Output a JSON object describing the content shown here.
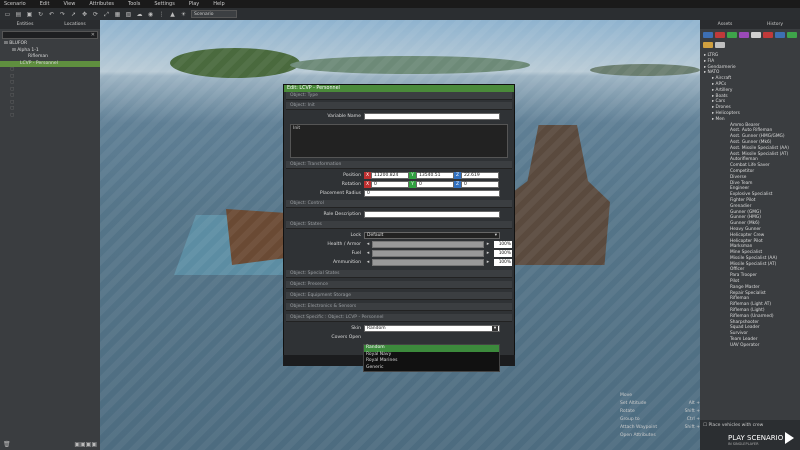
{
  "menubar": [
    "Scenario",
    "Edit",
    "View",
    "Attributes",
    "Tools",
    "Settings",
    "Play",
    "Help"
  ],
  "toolbar": {
    "mode_select": "Scenario"
  },
  "left_panel": {
    "tabs": [
      "Entities",
      "Locations"
    ],
    "tree": [
      {
        "label": "BLUFOR",
        "level": 0
      },
      {
        "label": "Alpha 1-1",
        "level": 1
      },
      {
        "label": "Rifleman",
        "level": 2
      },
      {
        "label": "LCVP - Personnel",
        "level": 1,
        "selected": true
      },
      {
        "label": "",
        "level": 0,
        "dim": true
      },
      {
        "label": "",
        "level": 0,
        "dim": true
      },
      {
        "label": "",
        "level": 0,
        "dim": true
      },
      {
        "label": "",
        "level": 0,
        "dim": true
      },
      {
        "label": "",
        "level": 0,
        "dim": true
      },
      {
        "label": "",
        "level": 0,
        "dim": true
      },
      {
        "label": "",
        "level": 0,
        "dim": true
      },
      {
        "label": "",
        "level": 0,
        "dim": true
      }
    ]
  },
  "right_panel": {
    "tabs": [
      "Assets",
      "History"
    ],
    "icon_colors": [
      "#3d6fb3",
      "#c03a3a",
      "#3ea44a",
      "#9a4ab8",
      "#d0d0d0",
      "#c03a3a",
      "#3d6fb3",
      "#3ea44a",
      "#d0a040",
      "#c0c0c0"
    ],
    "tree": [
      {
        "label": "LTRG",
        "indent": 0
      },
      {
        "label": "FIA",
        "indent": 0
      },
      {
        "label": "Gendarmerie",
        "indent": 0
      },
      {
        "label": "NATO",
        "indent": 0
      },
      {
        "label": "Aircraft",
        "indent": 1
      },
      {
        "label": "APCs",
        "indent": 1
      },
      {
        "label": "Artillery",
        "indent": 1
      },
      {
        "label": "Boats",
        "indent": 1
      },
      {
        "label": "Cars",
        "indent": 1
      },
      {
        "label": "Drones",
        "indent": 1
      },
      {
        "label": "Helicopters",
        "indent": 1
      },
      {
        "label": "Men",
        "indent": 1
      }
    ],
    "men": [
      "Ammo Bearer",
      "Asst. Auto Rifleman",
      "Asst. Gunner (HMG/GMG)",
      "Asst. Gunner (Mk6)",
      "Asst. Missile Specialist (AA)",
      "Asst. Missile Specialist (AT)",
      "Autorifleman",
      "Combat Life Saver",
      "Competitor",
      "Diverse",
      "Dive Team",
      "Engineer",
      "Explosive Specialist",
      "Fighter Pilot",
      "Grenadier",
      "Gunner (GMG)",
      "Gunner (HMG)",
      "Gunner (Mk6)",
      "Heavy Gunner",
      "Helicopter Crew",
      "Helicopter Pilot",
      "Marksman",
      "Mine Specialist",
      "Missile Specialist (AA)",
      "Missile Specialist (AT)",
      "Officer",
      "Para Trooper",
      "Pilot",
      "Range Master",
      "Repair Specialist",
      "Rifleman",
      "Rifleman (Light AT)",
      "Rifleman (Light)",
      "Rifleman (Unarmed)",
      "Sharpshooter",
      "Squad Leader",
      "Survivor",
      "Team Leader",
      "UAV Operator"
    ],
    "place_with_crew": "Place vehicles with crew",
    "play_button": "PLAY SCENARIO",
    "play_sub": "IN SINGLEPLAYER"
  },
  "hints": [
    {
      "label": "Move",
      "key": ""
    },
    {
      "label": "Set Altitude",
      "key": "Alt +"
    },
    {
      "label": "Rotate",
      "key": "Shift +"
    },
    {
      "label": "Group to",
      "key": "Ctrl +"
    },
    {
      "label": "Attach Waypoint",
      "key": "Shift +"
    },
    {
      "label": "Open Attributes",
      "key": ""
    }
  ],
  "dialog": {
    "title": "Edit: LCVP - Personnel",
    "sections": {
      "type": "Object: Type",
      "init": "Object: Init",
      "transformation": "Object: Transformation",
      "control": "Object: Control",
      "states": "Object: States",
      "special": "Object: Special States",
      "presence": "Object: Presence",
      "storage": "Object: Equipment Storage",
      "electronics": "Object: Electronics & Sensors",
      "specific": "Object Specific : Object: LCVP - Personnel"
    },
    "variable_name_label": "Variable Name",
    "init_label": "Init",
    "position_label": "Position",
    "pos_x": "11200.824",
    "pos_y": "13540.51",
    "pos_z": "22.619",
    "rotation_label": "Rotation",
    "rot_x": "0",
    "rot_y": "0",
    "rot_z": "0",
    "placement_radius_label": "Placement Radius",
    "placement_radius": "0",
    "role_description_label": "Role Description",
    "lock_label": "Lock",
    "lock_value": "Default",
    "health_label": "Health / Armor",
    "fuel_label": "Fuel",
    "ammo_label": "Ammunition",
    "health": "100%",
    "fuel": "100%",
    "ammo": "100%",
    "health_level": 1.0,
    "fuel_level": 1.0,
    "ammo_level": 1.0,
    "skin_label": "Skin",
    "skin_value": "Random",
    "covers_label": "Covers Open",
    "skin_options": [
      "Random",
      "Royal Navy",
      "Royal Marines",
      "Generic"
    ]
  },
  "axes": {
    "x": "X",
    "y": "Y",
    "z": "Z"
  }
}
